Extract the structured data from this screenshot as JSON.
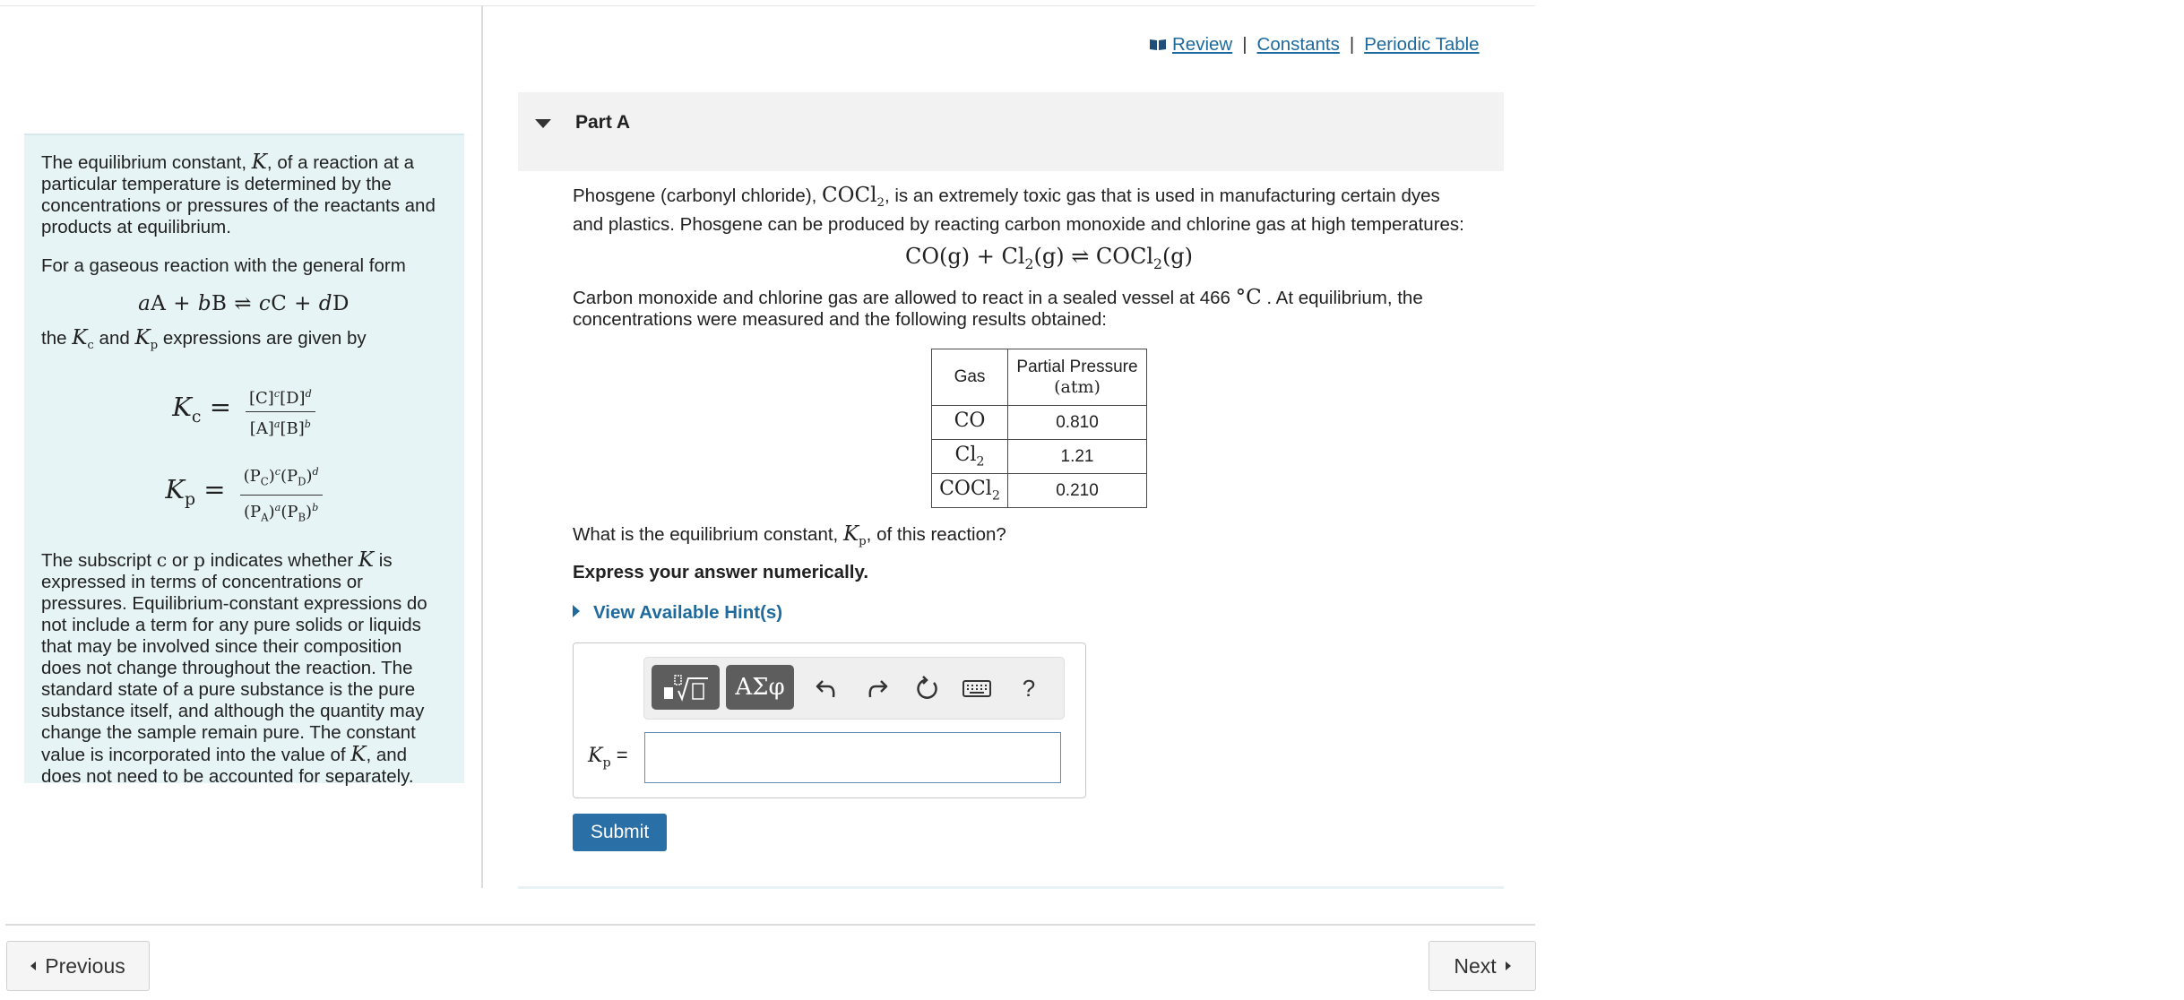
{
  "top_links": {
    "review": "Review",
    "separator": "|",
    "constants": "Constants",
    "periodic_table": "Periodic Table"
  },
  "info_panel": {
    "p1_a": "The equilibrium constant, ",
    "p1_K": "K",
    "p1_b": ", of a reaction at a particular temperature is determined by the concentrations or pressures of the reactants and products at equilibrium.",
    "p2": "For a gaseous reaction with the general form",
    "general_form": {
      "a": "a",
      "A": "A + ",
      "b": "b",
      "B": "B ⇌ ",
      "c": "c",
      "C": "C + ",
      "d": "d",
      "D": "D"
    },
    "p3_a": "the ",
    "p3_Kc_K": "K",
    "p3_Kc_sub": "c",
    "p3_and": " and ",
    "p3_Kp_K": "K",
    "p3_Kp_sub": "p",
    "p3_b": " expressions are given by",
    "kc_eq": {
      "lhs_K": "K",
      "lhs_sub": "c",
      "equals": "=",
      "num_1": "[C]",
      "num_1_exp": "c",
      "num_2": "[D]",
      "num_2_exp": "d",
      "den_1": "[A]",
      "den_1_exp": "a",
      "den_2": "[B]",
      "den_2_exp": "b"
    },
    "kp_eq": {
      "lhs_K": "K",
      "lhs_sub": "p",
      "equals": "=",
      "num_1_open": "(P",
      "num_1_sub": "C",
      "num_1_close": ")",
      "num_1_exp": "c",
      "num_2_open": "(P",
      "num_2_sub": "D",
      "num_2_close": ")",
      "num_2_exp": "d",
      "den_1_open": "(P",
      "den_1_sub": "A",
      "den_1_close": ")",
      "den_1_exp": "a",
      "den_2_open": "(P",
      "den_2_sub": "B",
      "den_2_close": ")",
      "den_2_exp": "b"
    },
    "p4_a": "The subscript ",
    "p4_c": "c",
    "p4_or": " or ",
    "p4_p": "p",
    "p4_b": " indicates whether ",
    "p4_K": "K",
    "p4_c2": " is expressed in terms of concentrations or pressures. Equilibrium-constant expressions do not include a term for any pure solids or liquids that may be involved since their composition does not change throughout the reaction. The standard state of a pure substance is the pure substance itself, and although the quantity may change the sample remain pure. The constant value is incorporated into the value of ",
    "p4_K2": "K",
    "p4_d": ", and does not need to be accounted for separately."
  },
  "part": {
    "title": "Part A",
    "q1_a": "Phosgene (carbonyl chloride), ",
    "q1_formula_main": "COCl",
    "q1_formula_sub": "2",
    "q1_b": ", is an extremely toxic gas that is used in manufacturing certain dyes and plastics. Phosgene can be produced by reacting carbon monoxide and chlorine gas at high temperatures:",
    "reaction": {
      "co": "CO(g) + Cl",
      "cl_sub": "2",
      "mid": "(g) ⇌ COCl",
      "prod_sub": "2",
      "end": "(g)"
    },
    "q2_a": "Carbon monoxide and chlorine gas are allowed to react in a sealed vessel at 466 ",
    "q2_unit": "°C",
    "q2_b": " . At equilibrium, the concentrations were measured and the following results obtained:",
    "table": {
      "header_gas": "Gas",
      "header_pp_line1": "Partial Pressure",
      "header_pp_line2": "(atm)",
      "rows": [
        {
          "gas": "CO",
          "gas_sub": "",
          "pressure": "0.810"
        },
        {
          "gas": "Cl",
          "gas_sub": "2",
          "pressure": "1.21"
        },
        {
          "gas": "COCl",
          "gas_sub": "2",
          "pressure": "0.210"
        }
      ]
    },
    "q3_a": "What is the equilibrium constant, ",
    "q3_K": "K",
    "q3_sub": "p",
    "q3_b": ", of this reaction?",
    "express": "Express your answer numerically.",
    "hint": "View Available Hint(s)",
    "toolbar": {
      "symbols_label": "ΑΣφ",
      "help_label": "?"
    },
    "answer_label_K": "K",
    "answer_label_sub": "p",
    "answer_label_eq": " =",
    "answer_value": "",
    "submit": "Submit"
  },
  "footer": {
    "previous": "Previous",
    "next": "Next"
  },
  "colors": {
    "link": "#1f6a9c",
    "submit_bg": "#2a6fa5",
    "info_panel_bg": "#e6f4f6",
    "toolbar_button_bg": "#5d5d5d"
  }
}
